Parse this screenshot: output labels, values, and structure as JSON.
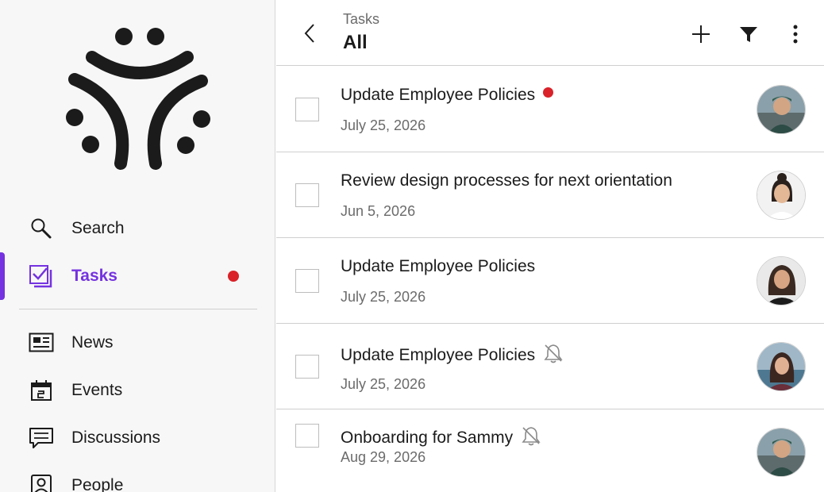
{
  "sidebar": {
    "nav": [
      {
        "label": "Search",
        "icon": "search-icon"
      },
      {
        "label": "Tasks",
        "icon": "tasks-icon",
        "active": true,
        "has_notification": true
      },
      {
        "label": "News",
        "icon": "news-icon"
      },
      {
        "label": "Events",
        "icon": "calendar-icon"
      },
      {
        "label": "Discussions",
        "icon": "discussions-icon"
      },
      {
        "label": "People",
        "icon": "people-icon"
      }
    ],
    "accent_color": "#7532e0",
    "notification_color": "#d92229"
  },
  "header": {
    "subtitle": "Tasks",
    "title": "All"
  },
  "tasks": [
    {
      "title": "Update Employee Policies",
      "date": "July 25, 2026",
      "marker": "red-dot"
    },
    {
      "title": "Review design processes for next orientation",
      "date": "Jun 5, 2026",
      "marker": "none"
    },
    {
      "title": "Update Employee Policies",
      "date": "July 25, 2026",
      "marker": "none"
    },
    {
      "title": "Update Employee Policies",
      "date": "July 25, 2026",
      "marker": "muted-bell"
    },
    {
      "title": "Onboarding for Sammy",
      "date": "Aug 29, 2026",
      "marker": "muted-bell"
    }
  ]
}
